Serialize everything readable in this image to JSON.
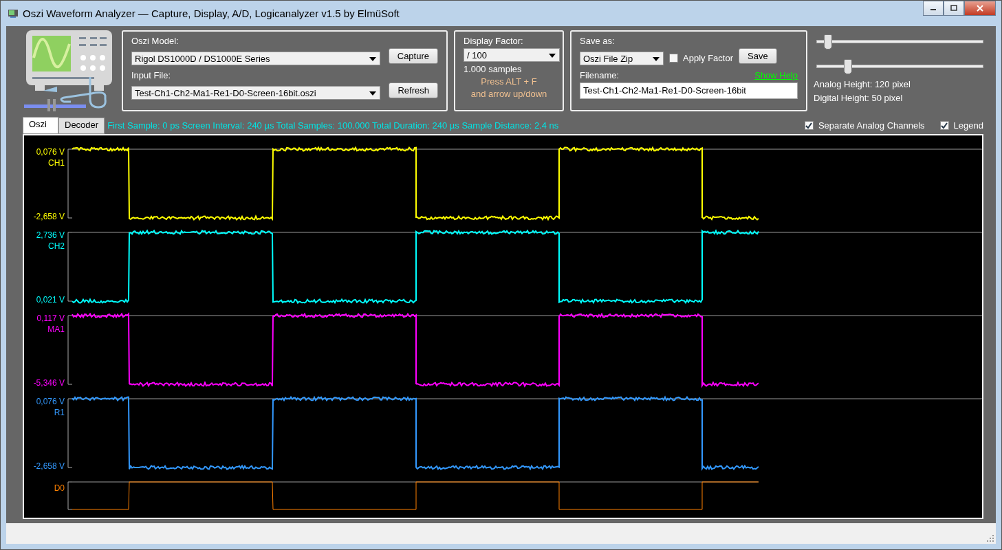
{
  "window": {
    "title": "Oszi Waveform Analyzer — Capture, Display, A/D, Logicanalyzer v1.5 by ElmüSoft"
  },
  "model_group": {
    "model_label": "Oszi Model:",
    "model_value": "Rigol DS1000D / DS1000E Series",
    "capture_button": "Capture",
    "file_label": "Input File:",
    "file_value": "Test-Ch1-Ch2-Ma1-Re1-D0-Screen-16bit.oszi",
    "refresh_button": "Refresh"
  },
  "display_group": {
    "label": "Display **F**actor:",
    "value": "/ 100",
    "samples": "1.000 samples",
    "hint_1": "Press ALT + F",
    "hint_2": "and arrow up/down"
  },
  "save_group": {
    "label": "Save as:",
    "format": "Oszi File Zip",
    "apply_factor": {
      "label": "Apply Factor",
      "checked": false
    },
    "save_button": "Save",
    "filename_label": "Filename:",
    "help_link": "Show Help",
    "filename": "Test-Ch1-Ch2-Ma1-Re1-D0-Screen-16bit"
  },
  "sliders": [
    {
      "level": 0.04
    },
    {
      "level": 0.16
    }
  ],
  "heights": [
    "Analog Height: 120 pixel",
    "Digital  Height: 50 pixel"
  ],
  "tabs": [
    {
      "label": "Oszi",
      "selected": true
    },
    {
      "label": "Decoder",
      "selected": false
    }
  ],
  "info": "First Sample: 0 ps  Screen Interval: 240 µs  Total Samples: 100.000  Total Duration: 240 µs  Sample Distance: 2.4 ns",
  "options": [
    {
      "label": "Separate Analog Channels",
      "checked": true
    },
    {
      "label": "Legend",
      "checked": true
    }
  ],
  "channels": [
    {
      "kind": "analog",
      "name": "CH1",
      "color": "#ffff00",
      "max_label": "0,076 V",
      "min_label": "-2,658 V",
      "starts_high": true
    },
    {
      "kind": "analog",
      "name": "CH2",
      "color": "#00ffff",
      "max_label": "2,736 V",
      "min_label": "0,021 V",
      "starts_high": false
    },
    {
      "kind": "analog",
      "name": "MA1",
      "color": "#ff00ff",
      "max_label": "0,117 V",
      "min_label": "-5,346 V",
      "starts_high": true
    },
    {
      "kind": "analog",
      "name": "R1",
      "color": "#3399ff",
      "max_label": "0,076 V",
      "min_label": "-2,658 V",
      "starts_high": true
    },
    {
      "kind": "digital",
      "name": "D0",
      "color": "#ff8000",
      "starts_high": false
    }
  ]
}
